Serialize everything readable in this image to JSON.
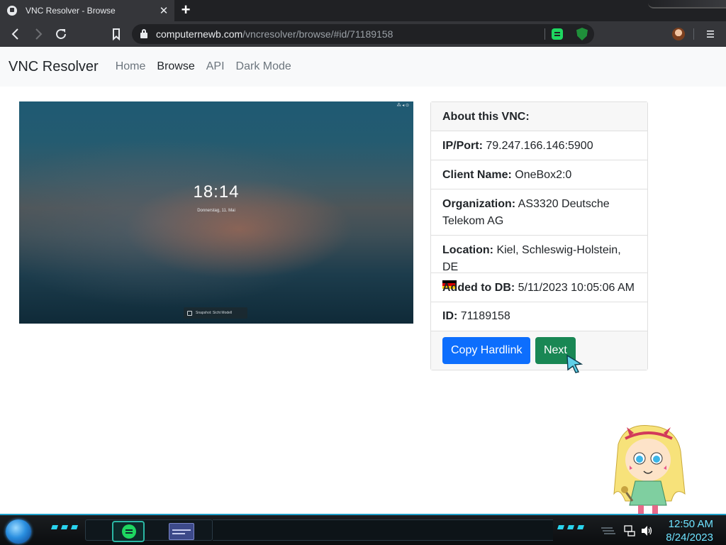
{
  "browser": {
    "tab_title": "VNC Resolver - Browse",
    "tab_close": "✕",
    "new_tab": "+",
    "url_host": "computernewb.com",
    "url_path": "/vncresolver/browse/#id/71189158"
  },
  "icons": {
    "back": "back-arrow-icon",
    "forward": "forward-arrow-icon",
    "reload": "reload-icon",
    "bookmark": "bookmark-icon",
    "lock": "lock-icon",
    "menu": "hamburger-menu-icon"
  },
  "nav": {
    "brand": "VNC Resolver",
    "links": [
      "Home",
      "Browse",
      "API",
      "Dark Mode"
    ]
  },
  "screenshot": {
    "time": "18:14",
    "date": "Donnerstag, 11. Mai",
    "login_hint": "Snapshot: Sicht Modell"
  },
  "card": {
    "header": "About this VNC:",
    "ip_label": "IP/Port:",
    "ip_value": "79.247.166.146:5900",
    "client_label": "Client Name:",
    "client_value": "OneBox2:0",
    "org_label": "Organization:",
    "org_value": "AS3320 Deutsche Telekom AG",
    "location_label": "Location:",
    "location_value": "Kiel, Schleswig-Holstein, DE",
    "added_label": "Added to DB:",
    "added_value": "5/11/2023 10:05:06 AM",
    "id_label": "ID:",
    "id_value": "71189158",
    "copy_button": "Copy Hardlink",
    "next_button": "Next"
  },
  "taskbar": {
    "time": "12:50 AM",
    "date": "8/24/2023"
  },
  "colors": {
    "primary": "#0d6efd",
    "success": "#198754",
    "browser_dark": "#35363a",
    "taskbar_accent": "#1e9ec9",
    "clock": "#6ee3ff"
  }
}
